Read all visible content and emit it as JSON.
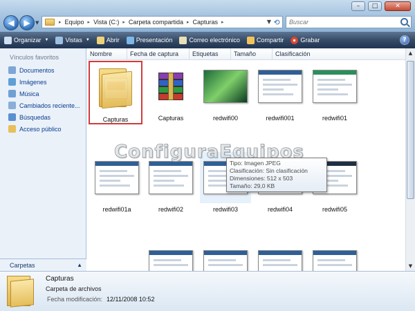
{
  "window": {
    "buttons": {
      "minimize": "–",
      "maximize": "□",
      "close": "✕"
    }
  },
  "address": {
    "crumbs": [
      "Equipo",
      "Vista (C:)",
      "Carpeta compartida",
      "Capturas"
    ]
  },
  "search": {
    "placeholder": "Buscar"
  },
  "toolbar": {
    "organize": "Organizar",
    "views": "Vistas",
    "open": "Abrir",
    "slideshow": "Presentación",
    "email": "Correo electrónico",
    "share": "Compartir",
    "burn": "Grabar",
    "help": "?"
  },
  "navpane": {
    "heading": "Vínculos favoritos",
    "items": [
      "Documentos",
      "Imágenes",
      "Música",
      "Cambiados reciente...",
      "Búsquedas",
      "Acceso público"
    ],
    "folders_label": "Carpetas"
  },
  "columns": [
    "Nombre",
    "Fecha de captura",
    "Etiquetas",
    "Tamaño",
    "Clasificación"
  ],
  "items": [
    {
      "name": "Capturas",
      "kind": "folder"
    },
    {
      "name": "Capturas",
      "kind": "archive"
    },
    {
      "name": "redwifi00",
      "kind": "image"
    },
    {
      "name": "redwifi001",
      "kind": "image"
    },
    {
      "name": "redwifi01",
      "kind": "image"
    },
    {
      "name": "redwifi01a",
      "kind": "image"
    },
    {
      "name": "redwifi02",
      "kind": "image"
    },
    {
      "name": "redwifi03",
      "kind": "image"
    },
    {
      "name": "redwifi04",
      "kind": "image"
    },
    {
      "name": "redwifi05",
      "kind": "image"
    }
  ],
  "tooltip": {
    "type": "Tipo: Imagen JPEG",
    "rating": "Clasificación: Sin clasificación",
    "dimensions": "Dimensiones: 512 x 503",
    "size": "Tamaño: 29,0 KB"
  },
  "watermark": "ConfiguraEquipos",
  "details": {
    "name": "Capturas",
    "type": "Carpeta de archivos",
    "modified_label": "Fecha modificación:",
    "modified_value": "12/11/2008 10:52"
  },
  "colors": {
    "toolbar": "#2b4262",
    "navpane": "#eaf1f9",
    "selection_border": "#d23a3a",
    "link": "#0a3d8f"
  }
}
